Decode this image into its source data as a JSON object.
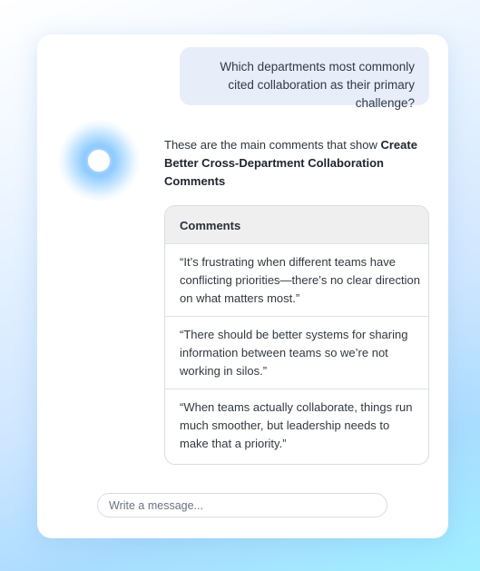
{
  "conversation": {
    "user_message": "Which departments most commonly cited collaboration as their primary challenge?",
    "bot_intro": "These are the main comments that show ",
    "bot_intro_bold": "Create Better Cross-Department Collaboration Comments"
  },
  "comments_table": {
    "header": "Comments",
    "rows": [
      "“It’s frustrating when different teams have conflicting priorities—there’s no clear direction on what matters most.”",
      "“There should be better systems for sharing information between teams so we’re not working in silos.”",
      "“When teams actually collaborate, things run much smoother, but leadership needs to make that a priority.”"
    ]
  },
  "composer": {
    "placeholder": "Write a message..."
  },
  "icons": {
    "assistant": "assistant-orb-icon"
  },
  "colors": {
    "user_bubble": "#e7eef9",
    "orb_glow": "#40a0ff",
    "table_header_bg": "#efefef"
  }
}
